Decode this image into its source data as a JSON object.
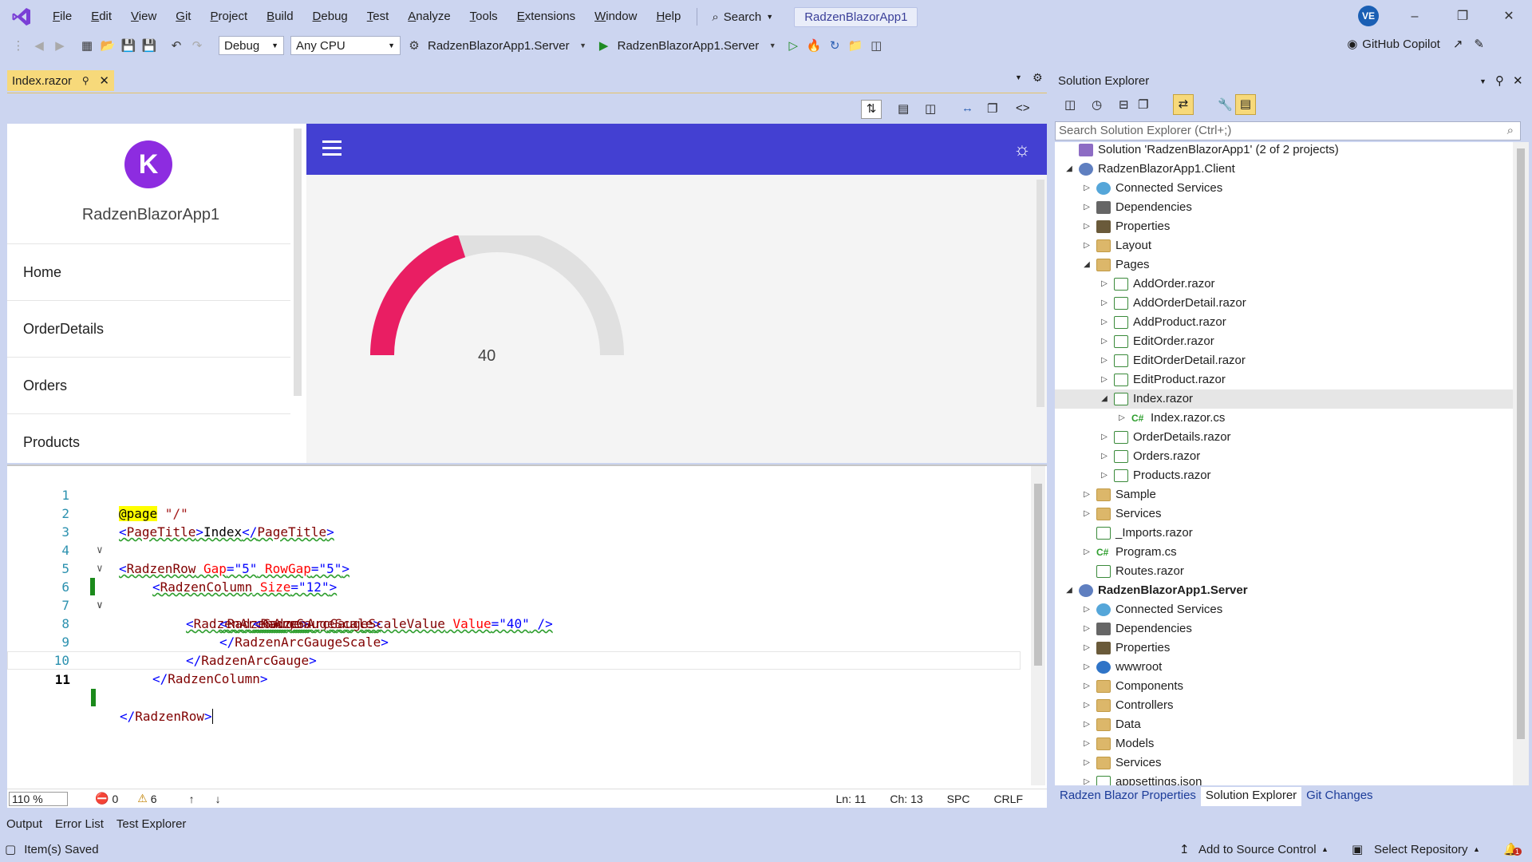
{
  "menu": [
    "File",
    "Edit",
    "View",
    "Git",
    "Project",
    "Build",
    "Debug",
    "Test",
    "Analyze",
    "Tools",
    "Extensions",
    "Window",
    "Help"
  ],
  "search_label": "Search",
  "app_title": "RadzenBlazorApp1",
  "avatar_initials": "VE",
  "toolbar": {
    "config": "Debug",
    "platform": "Any CPU",
    "startup_project": "RadzenBlazorApp1.Server",
    "run_target": "RadzenBlazorApp1.Server",
    "copilot": "GitHub Copilot"
  },
  "doc_tab": "Index.razor",
  "app": {
    "name": "RadzenBlazorApp1",
    "logo_letter": "K",
    "nav": [
      "Home",
      "OrderDetails",
      "Orders",
      "Products"
    ],
    "gauge_value": "40",
    "gauge_fraction": 0.4,
    "accent": "#4340d2",
    "gauge_color": "#e91e63"
  },
  "code": [
    {
      "n": "1"
    },
    {
      "n": "2"
    },
    {
      "n": "3"
    },
    {
      "n": "4"
    },
    {
      "n": "5"
    },
    {
      "n": "6"
    },
    {
      "n": "7"
    },
    {
      "n": "8"
    },
    {
      "n": "9"
    },
    {
      "n": "10"
    },
    {
      "n": "11"
    }
  ],
  "code_text": {
    "l1a": "@page",
    "l1b": " \"/\"",
    "l2a": "<",
    "l2b": "PageTitle",
    "l2c": ">",
    "l2d": "Index",
    "l2e": "</",
    "l2f": "PageTitle",
    "l2g": ">",
    "l3a": "<",
    "l3b": "RadzenRow",
    "l3c": " Gap",
    "l3d": "=\"5\"",
    "l3e": " RowGap",
    "l3f": "=\"5\"",
    "l3g": ">",
    "l4a": "<",
    "l4b": "RadzenColumn",
    "l4c": " Size",
    "l4d": "=\"12\"",
    "l4e": ">",
    "l5a": "<",
    "l5b": "RadzenArcGauge",
    "l5c": ">",
    "l6a": "<",
    "l6b": "RadzenArcGaugeScale",
    "l6c": ">",
    "l7a": "<",
    "l7b": "RadzenArcGaugeScaleValue",
    "l7c": " Value",
    "l7d": "=\"40\"",
    "l7e": " />",
    "l8a": "</",
    "l8b": "RadzenArcGaugeScale",
    "l8c": ">",
    "l9a": "</",
    "l9b": "RadzenArcGauge",
    "l9c": ">",
    "l10a": "</",
    "l10b": "RadzenColumn",
    "l10c": ">",
    "l11a": "</",
    "l11b": "RadzenRow",
    "l11c": ">"
  },
  "editor_status": {
    "zoom": "110 %",
    "errors": "0",
    "warnings": "6",
    "ln": "Ln: 11",
    "ch": "Ch: 13",
    "spc": "SPC",
    "crlf": "CRLF"
  },
  "bottom_tabs": [
    "Output",
    "Error List",
    "Test Explorer"
  ],
  "solution_explorer": {
    "title": "Solution Explorer",
    "search_placeholder": "Search Solution Explorer (Ctrl+;)",
    "tree": [
      "Solution 'RadzenBlazorApp1' (2 of 2 projects)",
      "RadzenBlazorApp1.Client",
      "Connected Services",
      "Dependencies",
      "Properties",
      "Layout",
      "Pages",
      "AddOrder.razor",
      "AddOrderDetail.razor",
      "AddProduct.razor",
      "EditOrder.razor",
      "EditOrderDetail.razor",
      "EditProduct.razor",
      "Index.razor",
      "Index.razor.cs",
      "OrderDetails.razor",
      "Orders.razor",
      "Products.razor",
      "Sample",
      "Services",
      "_Imports.razor",
      "Program.cs",
      "Routes.razor",
      "RadzenBlazorApp1.Server",
      "Connected Services",
      "Dependencies",
      "Properties",
      "wwwroot",
      "Components",
      "Controllers",
      "Data",
      "Models",
      "Services",
      "appsettings.json"
    ],
    "tabs": [
      "Radzen Blazor Properties",
      "Solution Explorer",
      "Git Changes"
    ]
  },
  "statusbar": {
    "saved": "Item(s) Saved",
    "source_control": "Add to Source Control",
    "repo": "Select Repository",
    "notif_count": "1"
  }
}
